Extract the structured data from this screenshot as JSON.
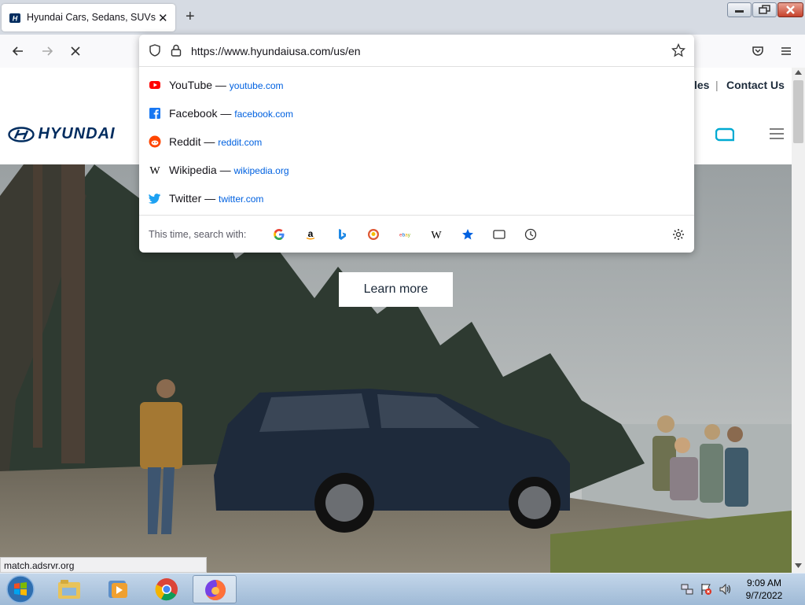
{
  "browser": {
    "tab_title": "Hyundai Cars, Sedans, SUVs, Co",
    "url": "https://www.hyundaiusa.com/us/en"
  },
  "suggestions": [
    {
      "name": "YouTube",
      "sep": "—",
      "domain": "youtube.com",
      "icon": "youtube-icon",
      "color": "#ff0000"
    },
    {
      "name": "Facebook",
      "sep": "—",
      "domain": "facebook.com",
      "icon": "facebook-icon",
      "color": "#1877f2"
    },
    {
      "name": "Reddit",
      "sep": "—",
      "domain": "reddit.com",
      "icon": "reddit-icon",
      "color": "#ff4500"
    },
    {
      "name": "Wikipedia",
      "sep": "—",
      "domain": "wikipedia.org",
      "icon": "wikipedia-icon",
      "color": "#000000"
    },
    {
      "name": "Twitter",
      "sep": "—",
      "domain": "twitter.com",
      "icon": "twitter-icon",
      "color": "#1da1f2"
    }
  ],
  "search_with": {
    "label": "This time, search with:",
    "engines": [
      "google-icon",
      "amazon-icon",
      "bing-icon",
      "duckduckgo-icon",
      "ebay-icon",
      "wikipedia-icon",
      "bookmarks-icon",
      "tabs-icon",
      "history-icon"
    ]
  },
  "site": {
    "utility_links": [
      "les",
      "|",
      "Contact Us"
    ],
    "logo_text": "HYUNDAI",
    "cta": "Learn more"
  },
  "status_text": "match.adsrvr.org",
  "taskbar": {
    "time": "9:09 AM",
    "date": "9/7/2022"
  }
}
